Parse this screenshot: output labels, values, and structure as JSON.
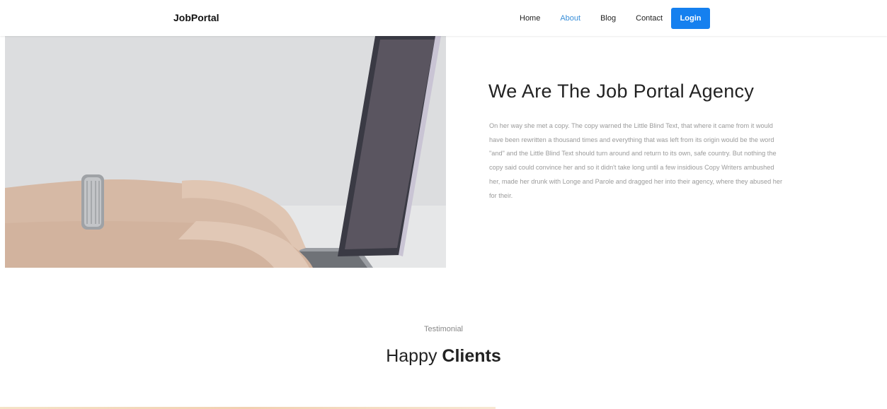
{
  "navbar": {
    "brand": "JobPortal",
    "links": [
      {
        "label": "Home"
      },
      {
        "label": "About",
        "active": true
      },
      {
        "label": "Blog"
      },
      {
        "label": "Contact"
      }
    ],
    "login_label": "Login",
    "accent_color": "#1580ef"
  },
  "about": {
    "title": "We Are The Job Portal Agency",
    "paragraph": "On her way she met a copy. The copy warned the Little Blind Text, that where it came from it would have been rewritten a thousand times and everything that was left from its origin would be the word \"and\" and the Little Blind Text should turn around and return to its own, safe country. But nothing the copy said could convince her and so it didn't take long until a few insidious Copy Writers ambushed her, made her drunk with Longe and Parole and dragged her into their agency, where they abused her for their."
  },
  "testimonial": {
    "subheading": "Testimonial",
    "title_light": "Happy",
    "title_bold": "Clients"
  }
}
